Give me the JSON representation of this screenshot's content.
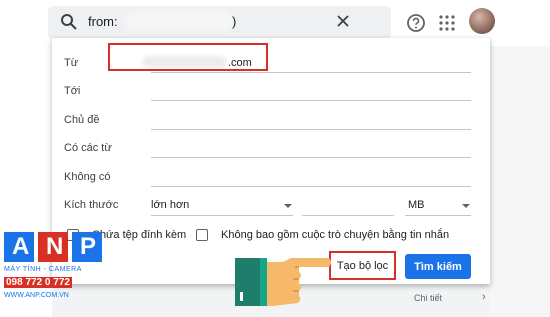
{
  "search": {
    "prefix": "from:",
    "suffix": ")"
  },
  "filter": {
    "from_label": "Từ",
    "from_value_domain": ".com",
    "to_label": "Tới",
    "subject_label": "Chủ đề",
    "has_words_label": "Có các từ",
    "doesnt_have_label": "Không có",
    "size_label": "Kích thước",
    "size_operator": "lớn hơn",
    "size_unit": "MB",
    "has_attachment_label": "Chứa tệp đính kèm",
    "exclude_chats_label": "Không bao gồm cuộc trò chuyện bằng tin nhắn",
    "create_filter_label": "Tạo bộ lọc",
    "search_button_label": "Tìm kiếm"
  },
  "background": {
    "below_text": "Chi tiết",
    "below_chevron": "›"
  },
  "watermark": {
    "letters": [
      "A",
      "N",
      "P"
    ],
    "tagline": "MÁY TÍNH - CAMERA",
    "phone": "098 772 0 772",
    "website": "WWW.ANP.COM.VN"
  },
  "colors": {
    "accent_blue": "#1a73e8",
    "highlight_red": "#d93025",
    "hand_skin": "#f6b96a",
    "sleeve_green": "#1e7d6b"
  },
  "icons": [
    "search-icon",
    "close-icon",
    "help-icon",
    "apps-icon",
    "pointing-hand-icon",
    "caret-down-icon"
  ]
}
